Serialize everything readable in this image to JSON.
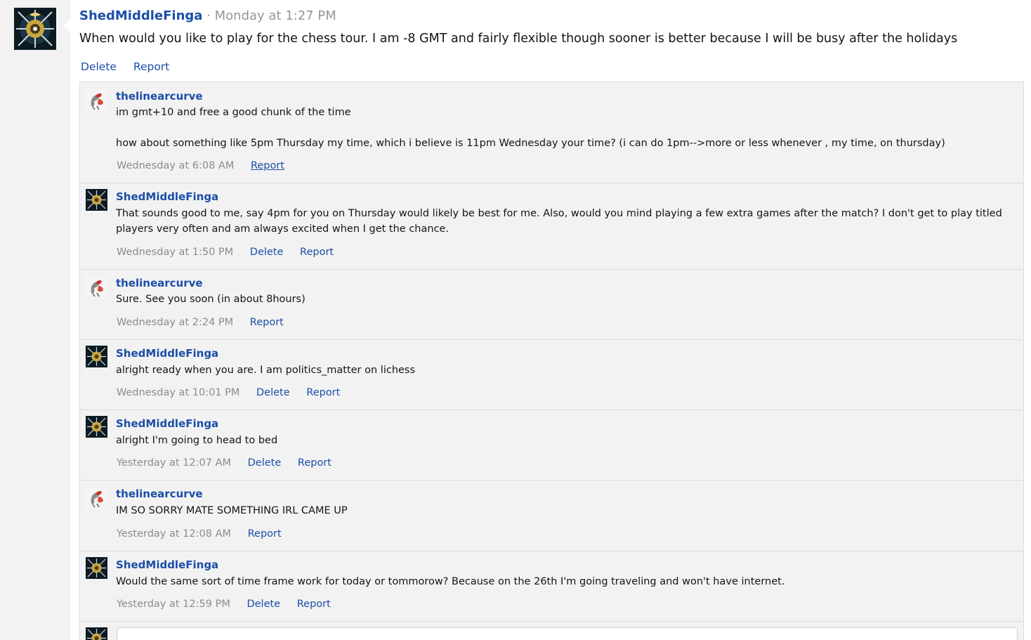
{
  "post": {
    "author": "ShedMiddleFinga",
    "separator": "·",
    "time": "Monday at 1:27 PM",
    "body": "When would you like to play for the chess tour. I am -8 GMT and fairly flexible though sooner is better because I will be busy after the holidays",
    "actions": {
      "delete": "Delete",
      "report": "Report"
    }
  },
  "comments": [
    {
      "author": "thelinearcurve",
      "avatar": "bird-avatar",
      "lines": [
        "im gmt+10 and free a good chunk of the time",
        "how about something like 5pm Thursday my time, which i believe is 11pm Wednesday your time? (i can do 1pm-->more or less whenever , my time, on thursday)"
      ],
      "time": "Wednesday at 6:08 AM",
      "report": "Report"
    },
    {
      "author": "ShedMiddleFinga",
      "avatar": "crest-avatar",
      "lines": [
        "That sounds good to me, say 4pm for you on Thursday would likely be best for me. Also, would you mind playing a few extra games after the match? I don't get to play titled players very often and am always excited when I get the chance."
      ],
      "time": "Wednesday at 1:50 PM",
      "delete": "Delete",
      "report": "Report"
    },
    {
      "author": "thelinearcurve",
      "avatar": "bird-avatar",
      "lines": [
        "Sure. See you soon (in about 8hours)"
      ],
      "time": "Wednesday at 2:24 PM",
      "report": "Report"
    },
    {
      "author": "ShedMiddleFinga",
      "avatar": "crest-avatar",
      "lines": [
        "alright ready when you are. I am politics_matter on lichess"
      ],
      "time": "Wednesday at 10:01 PM",
      "delete": "Delete",
      "report": "Report"
    },
    {
      "author": "ShedMiddleFinga",
      "avatar": "crest-avatar",
      "lines": [
        "alright I'm going to head to bed"
      ],
      "time": "Yesterday at 12:07 AM",
      "delete": "Delete",
      "report": "Report"
    },
    {
      "author": "thelinearcurve",
      "avatar": "bird-avatar",
      "lines": [
        "IM SO SORRY MATE SOMETHING IRL CAME UP"
      ],
      "time": "Yesterday at 12:08 AM",
      "report": "Report"
    },
    {
      "author": "ShedMiddleFinga",
      "avatar": "crest-avatar",
      "lines": [
        "Would the same sort of time frame work for today or tommorow? Because on the 26th I'm going traveling and won't have internet."
      ],
      "time": "Yesterday at 12:59 PM",
      "delete": "Delete",
      "report": "Report"
    }
  ],
  "colors": {
    "link": "#1b4ea8",
    "muted": "#8c8c8c",
    "panel": "#f2f2f2",
    "border": "#dcdcdc"
  }
}
